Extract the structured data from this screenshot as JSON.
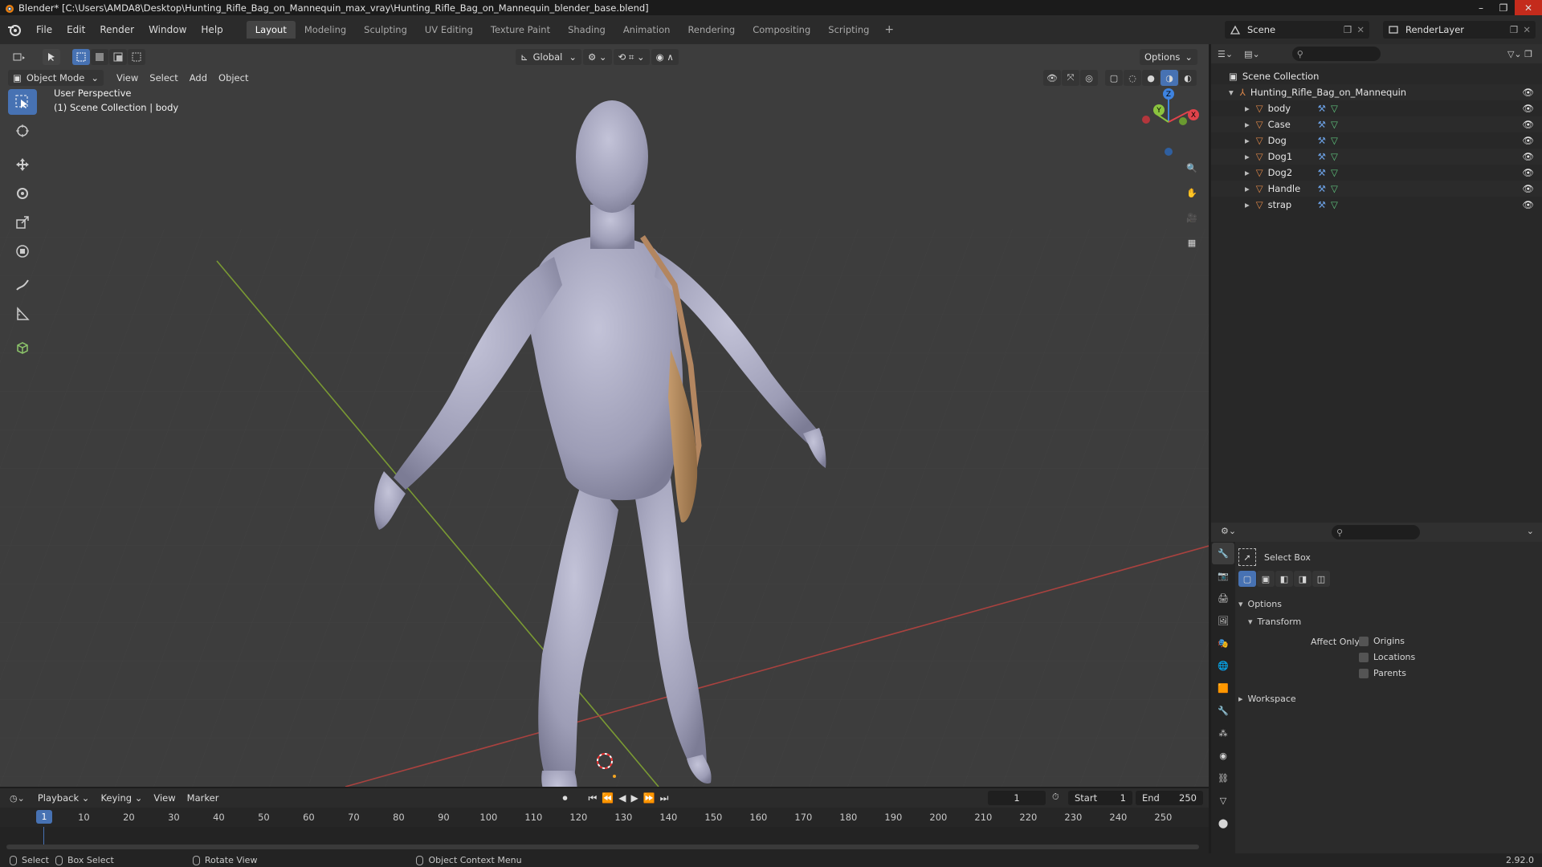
{
  "window": {
    "title": "Blender* [C:\\Users\\AMDA8\\Desktop\\Hunting_Rifle_Bag_on_Mannequin_max_vray\\Hunting_Rifle_Bag_on_Mannequin_blender_base.blend]",
    "min": "–",
    "max": "❐",
    "close": "✕"
  },
  "menubar": {
    "items": [
      "File",
      "Edit",
      "Render",
      "Window",
      "Help"
    ],
    "tabs": [
      "Layout",
      "Modeling",
      "Sculpting",
      "UV Editing",
      "Texture Paint",
      "Shading",
      "Animation",
      "Rendering",
      "Compositing",
      "Scripting"
    ],
    "active_tab": "Layout",
    "plus": "+",
    "scene": "Scene",
    "render_layer": "RenderLayer"
  },
  "viewport": {
    "mode": "Object Mode",
    "menus": [
      "View",
      "Select",
      "Add",
      "Object"
    ],
    "orientation": "Global",
    "options": "Options",
    "info_line1": "User Perspective",
    "info_line2": "(1) Scene Collection | body",
    "gizmo": {
      "x": "X",
      "y": "Y",
      "z": "Z"
    }
  },
  "outliner": {
    "root": "Scene Collection",
    "collection": "Hunting_Rifle_Bag_on_Mannequin",
    "objects": [
      "body",
      "Case",
      "Dog",
      "Dog1",
      "Dog2",
      "Handle",
      "strap"
    ]
  },
  "properties": {
    "tool_name": "Select Box",
    "options_label": "Options",
    "transform_label": "Transform",
    "affect_only": "Affect Only",
    "checks": [
      "Origins",
      "Locations",
      "Parents"
    ],
    "workspace_label": "Workspace"
  },
  "timeline": {
    "menus": [
      "Playback",
      "Keying",
      "View",
      "Marker"
    ],
    "current_frame": "1",
    "start_label": "Start",
    "start": "1",
    "end_label": "End",
    "end": "250",
    "playhead": "1",
    "ticks": [
      "10",
      "20",
      "30",
      "40",
      "50",
      "60",
      "70",
      "80",
      "90",
      "100",
      "110",
      "120",
      "130",
      "140",
      "150",
      "160",
      "170",
      "180",
      "190",
      "200",
      "210",
      "220",
      "230",
      "240",
      "250"
    ]
  },
  "statusbar": {
    "select": "Select",
    "box_select": "Box Select",
    "rotate_view": "Rotate View",
    "context_menu": "Object Context Menu",
    "version": "2.92.0"
  },
  "colors": {
    "accent": "#4772b3",
    "x_axis": "#e0434b",
    "y_axis": "#8bc43f",
    "z_axis": "#3e83e0",
    "object_orange": "#e0894a"
  }
}
